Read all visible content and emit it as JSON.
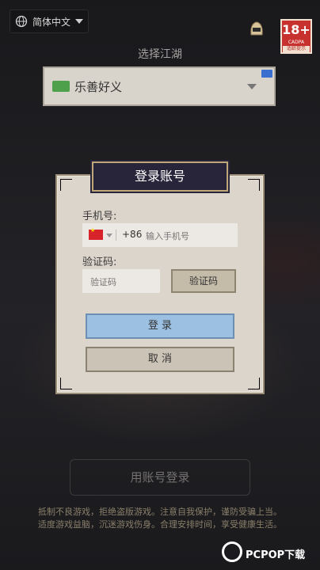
{
  "top": {
    "language": "简体中文",
    "age_number": "18+",
    "age_line1": "CADPA",
    "age_line2": "适龄提示"
  },
  "server_select": {
    "title": "选择江湖",
    "server_name": "乐善好义"
  },
  "dialog": {
    "title": "登录账号",
    "phone_label": "手机号:",
    "country_code": "+86",
    "phone_placeholder": "输入手机号",
    "code_label": "验证码:",
    "code_placeholder": "验证码",
    "get_code_button": "验证码",
    "login_button": "登 录",
    "cancel_button": "取 消"
  },
  "account_login_button": "用账号登录",
  "health_notice": {
    "line1": "抵制不良游戏，拒绝盗版游戏。注意自我保护，谨防受骗上当。",
    "line2": "适度游戏益脑，沉迷游戏伤身。合理安排时间，享受健康生活。"
  },
  "watermark": "PCPOP下载",
  "colors": {
    "dialog_header_bg": "#28243a",
    "login_button": "#9cc0e2",
    "age_badge": "#c8322e"
  }
}
